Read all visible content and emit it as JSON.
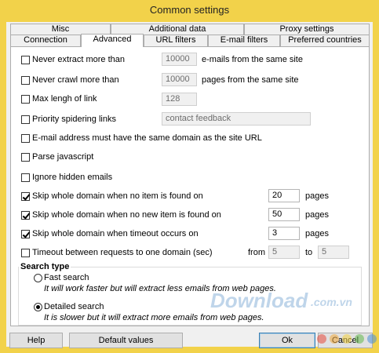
{
  "window": {
    "title": "Common settings"
  },
  "tabs": {
    "back_row": [
      "Misc",
      "Additional data",
      "Proxy settings"
    ],
    "front_row": [
      "Connection",
      "Advanced",
      "URL filters",
      "E-mail filters",
      "Preferred countries"
    ],
    "active": "Advanced"
  },
  "options": {
    "never_extract": {
      "label": "Never extract more than",
      "checked": false,
      "value": "10000",
      "suffix": "e-mails from the same site"
    },
    "never_crawl": {
      "label": "Never crawl more than",
      "checked": false,
      "value": "10000",
      "suffix": "pages from the same site"
    },
    "max_link": {
      "label": "Max lengh of link",
      "checked": false,
      "value": "128"
    },
    "priority": {
      "label": "Priority spidering links",
      "checked": false,
      "value": "contact feedback"
    },
    "same_domain": {
      "label": "E-mail address must have the same domain as the site URL",
      "checked": false
    },
    "parse_js": {
      "label": "Parse javascript",
      "checked": false
    },
    "ignore_hidden": {
      "label": "Ignore hidden emails",
      "checked": false
    },
    "skip_no_item": {
      "label": "Skip whole domain when no item is found on",
      "checked": true,
      "value": "20",
      "suffix": "pages"
    },
    "skip_no_new": {
      "label": "Skip whole domain when no new item is found on",
      "checked": true,
      "value": "50",
      "suffix": "pages"
    },
    "skip_timeout": {
      "label": "Skip whole domain when timeout occurs on",
      "checked": true,
      "value": "3",
      "suffix": "pages"
    },
    "timeout_between": {
      "label": "Timeout between requests to one domain (sec)",
      "checked": false,
      "from_label": "from",
      "from_value": "5",
      "to_label": "to",
      "to_value": "5"
    }
  },
  "search_type": {
    "title": "Search type",
    "fast": {
      "label": "Fast search",
      "hint": "It will work faster but will extract less emails from web pages.",
      "selected": false
    },
    "detailed": {
      "label": "Detailed search",
      "hint": "It is slower but it will extract more emails from web pages.",
      "selected": true
    }
  },
  "buttons": {
    "help": "Help",
    "defaults": "Default values",
    "ok": "Ok",
    "cancel": "Cancel"
  },
  "watermark": {
    "text": "Download",
    "suffix": ".com.vn"
  },
  "colors": {
    "title_bar": "#f2d24a",
    "client_bg": "#f0f0f0",
    "panel_bg": "#ffffff"
  }
}
